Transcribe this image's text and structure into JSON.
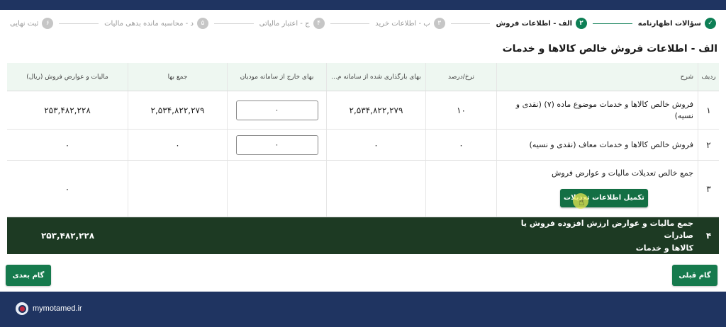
{
  "stepper": {
    "steps": [
      {
        "num": "✓",
        "label": "سؤالات اظهارنامه"
      },
      {
        "num": "۲",
        "label": "الف - اطلاعات فروش"
      },
      {
        "num": "۳",
        "label": "ب - اطلاعات خرید"
      },
      {
        "num": "۴",
        "label": "ج - اعتبار مالیاتی"
      },
      {
        "num": "۵",
        "label": "د - محاسبه مانده بدهی مالیات"
      },
      {
        "num": "۶",
        "label": "ثبت نهایی"
      }
    ]
  },
  "page_title": "الف - اطلاعات فروش خالص کالاها و خدمات",
  "table": {
    "headers": {
      "row": "ردیف",
      "desc": "شرح",
      "rate": "نرخ/درصد",
      "system_price": "بهای بارگذاری شده از سامانه م...",
      "external_price": "بهای خارج از سامانه مودیان",
      "total_price": "جمع بها",
      "tax": "مالیات و عوارض فروش (ریال)"
    },
    "rows": [
      {
        "num": "۱",
        "desc": "فروش خالص کالاها و خدمات موضوع ماده (۷) (نقدی و نسیه)",
        "rate": "۱۰",
        "system_price": "۲,۵۳۴,۸۲۲,۲۷۹",
        "external_input": "۰",
        "total_price": "۲,۵۳۴,۸۲۲,۲۷۹",
        "tax": "۲۵۳,۴۸۲,۲۲۸"
      },
      {
        "num": "۲",
        "desc": "فروش خالص کالاها و خدمات معاف (نقدی و نسیه)",
        "rate": "۰",
        "system_price": "۰",
        "external_input": "۰",
        "total_price": "۰",
        "tax": "۰"
      },
      {
        "num": "۳",
        "desc": "جمع خالص تعدیلات مالیات و عوارض فروش",
        "button": "تکمیل اطلاعات تعدیلات",
        "tax": "۰"
      },
      {
        "num": "۴",
        "desc_line1": "جمع مالیات و عوارض ارزش افزوده فروش یا صادرات",
        "desc_line2": "کالاها و خدمات",
        "tax": "۲۵۳,۴۸۲,۲۲۸"
      }
    ]
  },
  "buttons": {
    "prev": "گام قبلی",
    "next": "گام بعدی"
  },
  "footer": {
    "site": "mymotamed.ir"
  }
}
